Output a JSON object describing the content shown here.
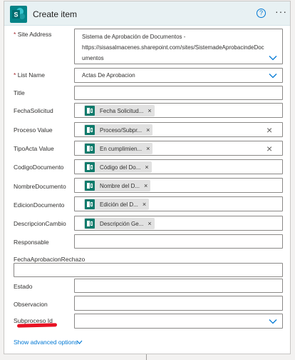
{
  "action": {
    "title": "Create item",
    "help_glyph": "?",
    "more_glyph": "···"
  },
  "fields": {
    "site_address": {
      "label": "Site Address",
      "required": "*",
      "value_lines": [
        "Sistema de Aprobación de Documentos -",
        "https://sisasalmacenes.sharepoint.com/sites/SistemadeAprobacindeDoc",
        "umentos"
      ]
    },
    "list_name": {
      "label": "List Name",
      "required": "*",
      "value": "Actas De Aprobacion"
    },
    "title": {
      "label": "Title"
    },
    "fecha_solicitud": {
      "label": "FechaSolicitud",
      "token": "Fecha Solicitud...",
      "token_remove": "×"
    },
    "proceso_value": {
      "label": "Proceso Value",
      "token": "Proceso/Subpr...",
      "token_remove": "×",
      "clear": "×"
    },
    "tipo_acta_value": {
      "label": "TipoActa Value",
      "token": "En cumplimien...",
      "token_remove": "×",
      "clear": "×"
    },
    "codigo_documento": {
      "label": "CodigoDocumento",
      "token": "Código del Do...",
      "token_remove": "×"
    },
    "nombre_documento": {
      "label": "NombreDocumento",
      "token": "Nombre del D...",
      "token_remove": "×"
    },
    "edicion_documento": {
      "label": "EdicionDocumento",
      "token": "Edición del D...",
      "token_remove": "×"
    },
    "descripcion_cambio": {
      "label": "DescripcionCambio",
      "token": "Descripción Ge...",
      "token_remove": "×"
    },
    "responsable": {
      "label": "Responsable"
    },
    "fecha_aprobacion_rechazo": {
      "label": "FechaAprobacionRechazo"
    },
    "estado": {
      "label": "Estado"
    },
    "observacion": {
      "label": "Observacion"
    },
    "subproceso_id": {
      "label": "Subproceso Id"
    }
  },
  "footer": {
    "show_advanced": "Show advanced options"
  },
  "colors": {
    "header_bg": "#e8f1f3",
    "accent": "#0078d4",
    "token_icon": "#0f7b6c",
    "sharepoint_icon": "#038387",
    "annotation_red": "#e81123"
  },
  "icons": {
    "action": "sharepoint-icon",
    "help": "help-circle-icon",
    "more": "more-options-icon",
    "dropdown": "chevron-down-icon",
    "token": "sharepoint-token-icon"
  }
}
